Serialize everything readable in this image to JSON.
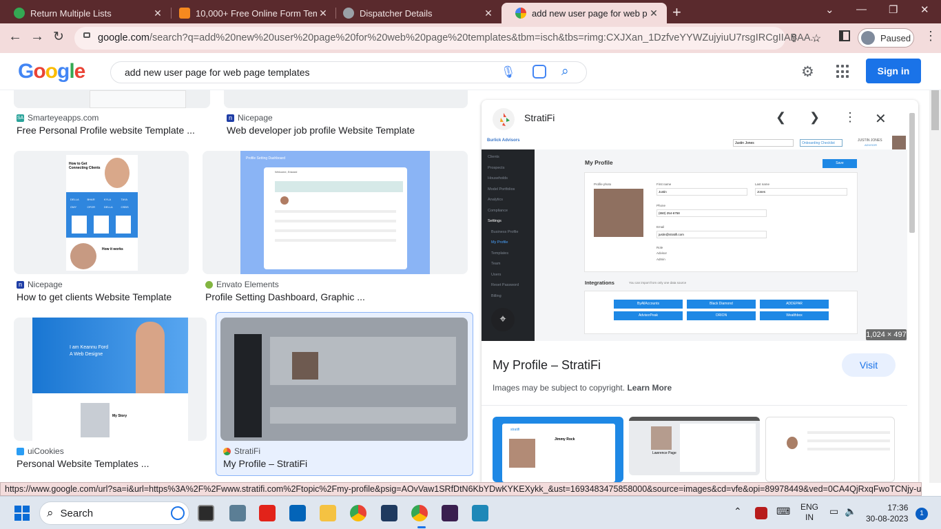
{
  "browser": {
    "tabs": [
      {
        "label": "Return Multiple Lists",
        "favicon_color": "#34a853"
      },
      {
        "label": "10,000+ Free Online Form Templ",
        "favicon_color": "#f6891f"
      },
      {
        "label": "Dispatcher Details",
        "favicon_color": "#9aa0a6"
      },
      {
        "label": "add new user page for web page",
        "favicon_color": "#4285f4"
      }
    ],
    "url_domain": "google.com",
    "url_rest": "/search?q=add%20new%20user%20page%20for%20web%20page%20templates&tbm=isch&tbs=rimg:CXJXan_1DzfveYYWZujyiuU7rsgIRCgIIABAA...",
    "profile_label": "Paused"
  },
  "google": {
    "logo": "Google",
    "query": "add new user page for web page templates",
    "signin_label": "Sign in"
  },
  "results": [
    {
      "source": "Smarteyeapps.com",
      "title": "Free Personal Profile website Template ...",
      "badge": "SA",
      "badge_color": "#2aa39a"
    },
    {
      "source": "Nicepage",
      "title": "Web developer job profile Website Template",
      "badge": "n",
      "badge_color": "#1f3ea6"
    },
    {
      "source": "Nicepage",
      "title": "How to get clients Website Template",
      "badge": "n",
      "badge_color": "#1f3ea6"
    },
    {
      "source": "Envato Elements",
      "title": "Profile Setting Dashboard, Graphic ...",
      "badge": "",
      "badge_color": "#82b541"
    },
    {
      "source": "uiCookies",
      "title": "Personal Website Templates ...",
      "badge": "",
      "badge_color": "#2a9df4"
    },
    {
      "source": "StratiFi",
      "title": "My Profile – StratiFi",
      "badge": "",
      "badge_color": "#e94e3c"
    }
  ],
  "thumb_texts": {
    "clients_heading": "How to Get Connecting Clients",
    "how_it_works": "How it works",
    "logos": [
      "DELLA",
      "BHAR",
      "KYLA",
      "TAYA",
      "OMY",
      "OFOR",
      "DELLA",
      "OSBS"
    ],
    "dashboard_label": "Profile Setting Dashboard",
    "dashboard_sub": "Welcome, Edward",
    "hero_line1": "I am Keannu Ford",
    "hero_line2": "A Web Designe",
    "my_story": "My Story"
  },
  "preview": {
    "site": "StratiFi",
    "image_dims": "1,024 × 497",
    "title": "My Profile – StratiFi",
    "visit_label": "Visit",
    "copyright_text": "Images may be subject to copyright.",
    "learn_more": "Learn More",
    "mock": {
      "brand": "Burlick Advisors",
      "select_value": "Justin Jones",
      "checklist_btn": "Onboarding Checklist",
      "user_name": "JUSTIN JONES",
      "user_role": "ADVISOR",
      "sidebar": [
        "Clients",
        "Prospects",
        "Households",
        "Model Portfolios",
        "Analytics",
        "Compliance",
        "Settings",
        "Business Profile",
        "My Profile",
        "Templates",
        "Team",
        "Users",
        "Reset Password",
        "Billing"
      ],
      "page_title": "My Profile",
      "save": "Save",
      "profile_photo": "Profile photo",
      "first_name_label": "First name",
      "first_name": "Justin",
      "last_name_label": "Last name",
      "last_name": "Jones",
      "phone_label": "Phone",
      "phone": "(650) 254-6758",
      "email_label": "Email",
      "email": "justin@stratifi.com",
      "role_label": "Role",
      "role_1": "Advisor",
      "role_2": "Admin",
      "integrations_title": "Integrations",
      "integrations_sub": "You can import from only one data source",
      "integrations": [
        "ByAllAccounts",
        "Black Diamond",
        "ADDEPAR",
        "AdvisorPeak",
        "ORION",
        "Wealthbox"
      ]
    },
    "related_texts": {
      "r1_brand": "stratifi",
      "r1_name": "Jimmy Rock",
      "r2_name": "Lawrence Page"
    }
  },
  "status_url": "https://www.google.com/url?sa=i&url=https%3A%2F%2Fwww.stratifi.com%2Ftopic%2Fmy-profile&psig=AOvVaw1SRfDtN6KbYDwKYKEXykk_&ust=1693483475858000&source=images&cd=vfe&opi=89978449&ved=0CA4QjRxqFwoTCNjy-uWrhIEDF...",
  "taskbar": {
    "search_label": "Search",
    "lang_1": "ENG",
    "lang_2": "IN",
    "time": "17:36",
    "date": "30-08-2023",
    "notif_count": "1"
  }
}
